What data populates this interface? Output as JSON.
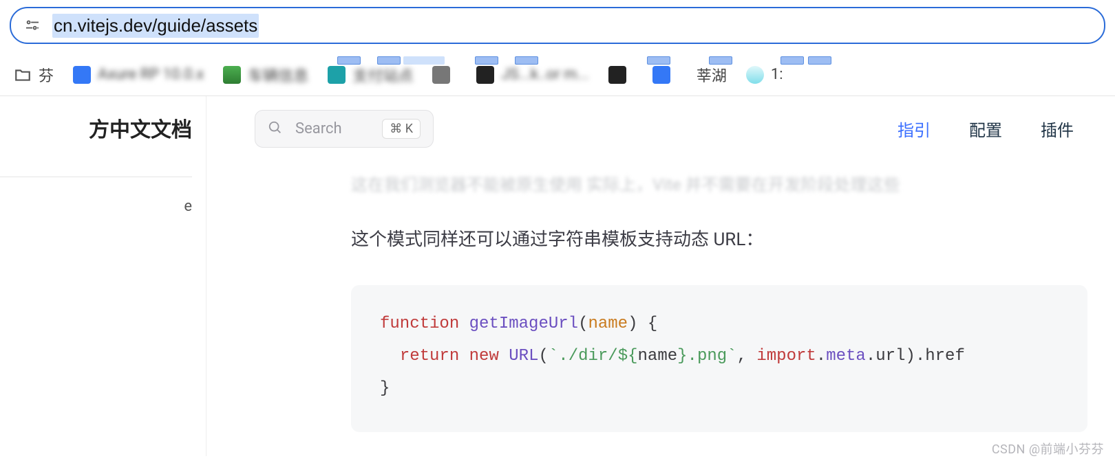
{
  "url": "cn.vitejs.dev/guide/assets",
  "bookmarks": [
    {
      "label": "芬",
      "icon": "folder"
    },
    {
      "label": "Axure RP 10.0.x",
      "icon": "blue",
      "blur": true
    },
    {
      "label": "车辆信息",
      "icon": "green",
      "blur": true
    },
    {
      "label": "支付站点",
      "icon": "teal",
      "blur": true
    },
    {
      "label": "",
      "icon": "grey",
      "blur": true
    },
    {
      "label": "JS...k..or m...",
      "icon": "black",
      "blur": true
    },
    {
      "label": "",
      "icon": "black",
      "blur": true
    },
    {
      "label": "",
      "icon": "blue",
      "blur": true
    },
    {
      "label": "莘湖",
      "icon": "none"
    },
    {
      "label": "1:",
      "icon": "robot"
    }
  ],
  "sidebar": {
    "title_partial": "方中文文档",
    "link_partial": "e"
  },
  "search": {
    "placeholder": "Search",
    "shortcut": "⌘ K"
  },
  "nav": {
    "guide": "指引",
    "config": "配置",
    "plugins": "插件"
  },
  "content": {
    "faded": "这在我们测览器不能被原生使用 实际上，Vite 并不需要在开发阶段处理这些",
    "paragraph": "这个模式同样还可以通过字符串模板支持动态 URL：",
    "code": {
      "kw_function": "function",
      "fn_name": "getImageUrl",
      "arg": "name",
      "kw_return": "return",
      "kw_new": "new",
      "cls": "URL",
      "str_open": "`./dir/",
      "tpl_open": "${",
      "tpl_var": "name",
      "tpl_close": "}",
      "str_close": ".png`",
      "kw_import": "import",
      "prop_meta": "meta",
      "prop_url": "url",
      "prop_href": "href"
    }
  },
  "watermark": "CSDN @前端小芬芬"
}
